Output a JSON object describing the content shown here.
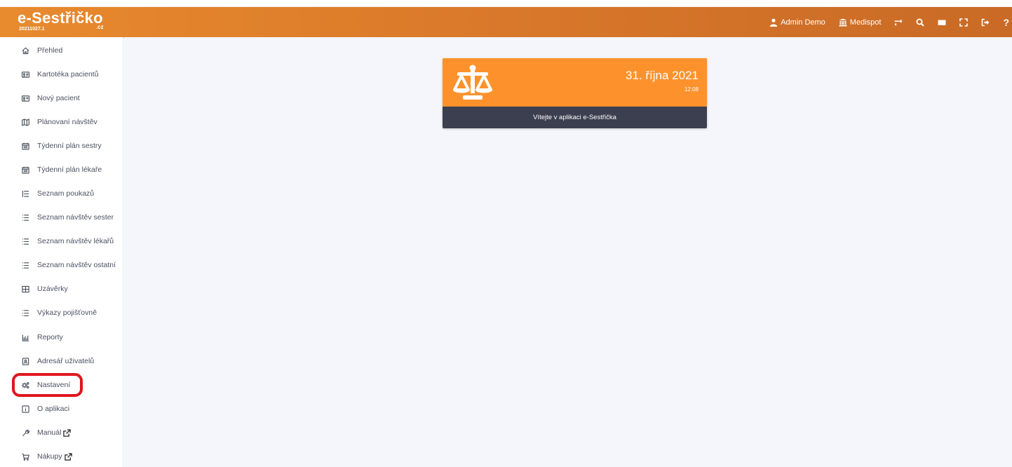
{
  "header": {
    "logo_text": "e-Sestřičko",
    "logo_cz": ".cz",
    "version": "20211027.1",
    "user_label": "Admin Demo",
    "org_label": "Medispot",
    "help_label": "?"
  },
  "sidebar": {
    "items": [
      {
        "label": "Přehled",
        "icon": "home-icon"
      },
      {
        "label": "Kartotéka pacientů",
        "icon": "id-card-icon"
      },
      {
        "label": "Nový pacient",
        "icon": "id-card-icon"
      },
      {
        "label": "Plánovaní návštěv",
        "icon": "map-icon"
      },
      {
        "label": "Týdenní plán sestry",
        "icon": "calendar-icon"
      },
      {
        "label": "Týdenní plán lékaře",
        "icon": "calendar-icon"
      },
      {
        "label": "Seznam poukazů",
        "icon": "list-icon"
      },
      {
        "label": "Seznam návštěv sester",
        "icon": "list-icon"
      },
      {
        "label": "Seznam návštěv lékařů",
        "icon": "list-icon"
      },
      {
        "label": "Seznam návštěv ostatní",
        "icon": "list-icon"
      },
      {
        "label": "Uzávěrky",
        "icon": "table-icon"
      },
      {
        "label": "Výkazy pojišťovně",
        "icon": "list-icon"
      },
      {
        "label": "Reporty",
        "icon": "report-icon"
      },
      {
        "label": "Adresář uživatelů",
        "icon": "contact-book-icon"
      },
      {
        "label": "Nastavení",
        "icon": "gears-icon"
      },
      {
        "label": "O aplikaci",
        "icon": "info-icon"
      },
      {
        "label": "Manuál",
        "icon": "wrench-icon"
      },
      {
        "label": "Nákupy",
        "icon": "cart-icon"
      }
    ]
  },
  "card": {
    "date": "31. října 2021",
    "time": "12:08",
    "welcome": "Vítejte v aplikaci e-Sestřička"
  },
  "colors": {
    "topbar": "#e0822c",
    "card_top": "#fd922c",
    "card_bottom": "#3b3f4f",
    "highlight": "#e0161e",
    "main_bg": "#f4f6fb"
  }
}
